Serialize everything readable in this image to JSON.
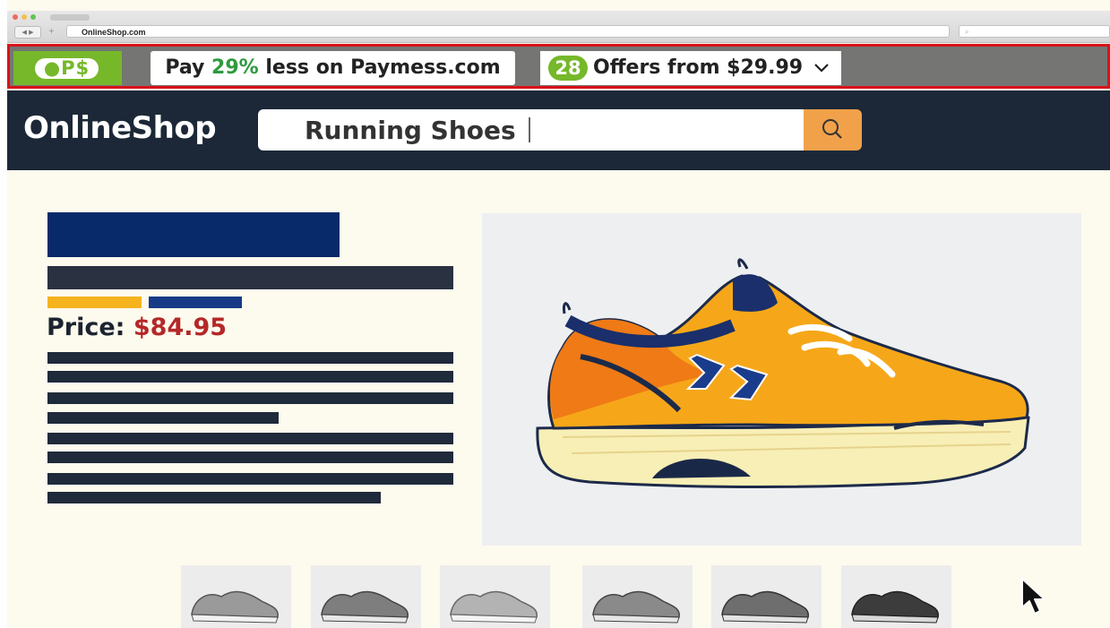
{
  "browser": {
    "url": "OnlineShop.com",
    "traffic_lights": [
      "#ed6b5f",
      "#f5bf4f",
      "#61c454"
    ]
  },
  "extension": {
    "logo_text": "●P$",
    "pay_prefix": "Pay ",
    "pay_percent": "29%",
    "pay_suffix": " less on Paymess.com",
    "offers_count": "28",
    "offers_text": "Offers from $29.99",
    "colors": {
      "brand_green": "#76b82a",
      "highlight_red": "#d9121a",
      "percent_green": "#2f9a3f"
    }
  },
  "site": {
    "logo": "OnlineShop",
    "search_value": "Running Shoes",
    "search_icon": "search-icon",
    "header_bg": "#1c2837",
    "search_button_color": "#f0a14a"
  },
  "product": {
    "price_label": "Price: ",
    "price_value": "$84.95",
    "price_color": "#b42828",
    "thumbnail_count": 6
  }
}
